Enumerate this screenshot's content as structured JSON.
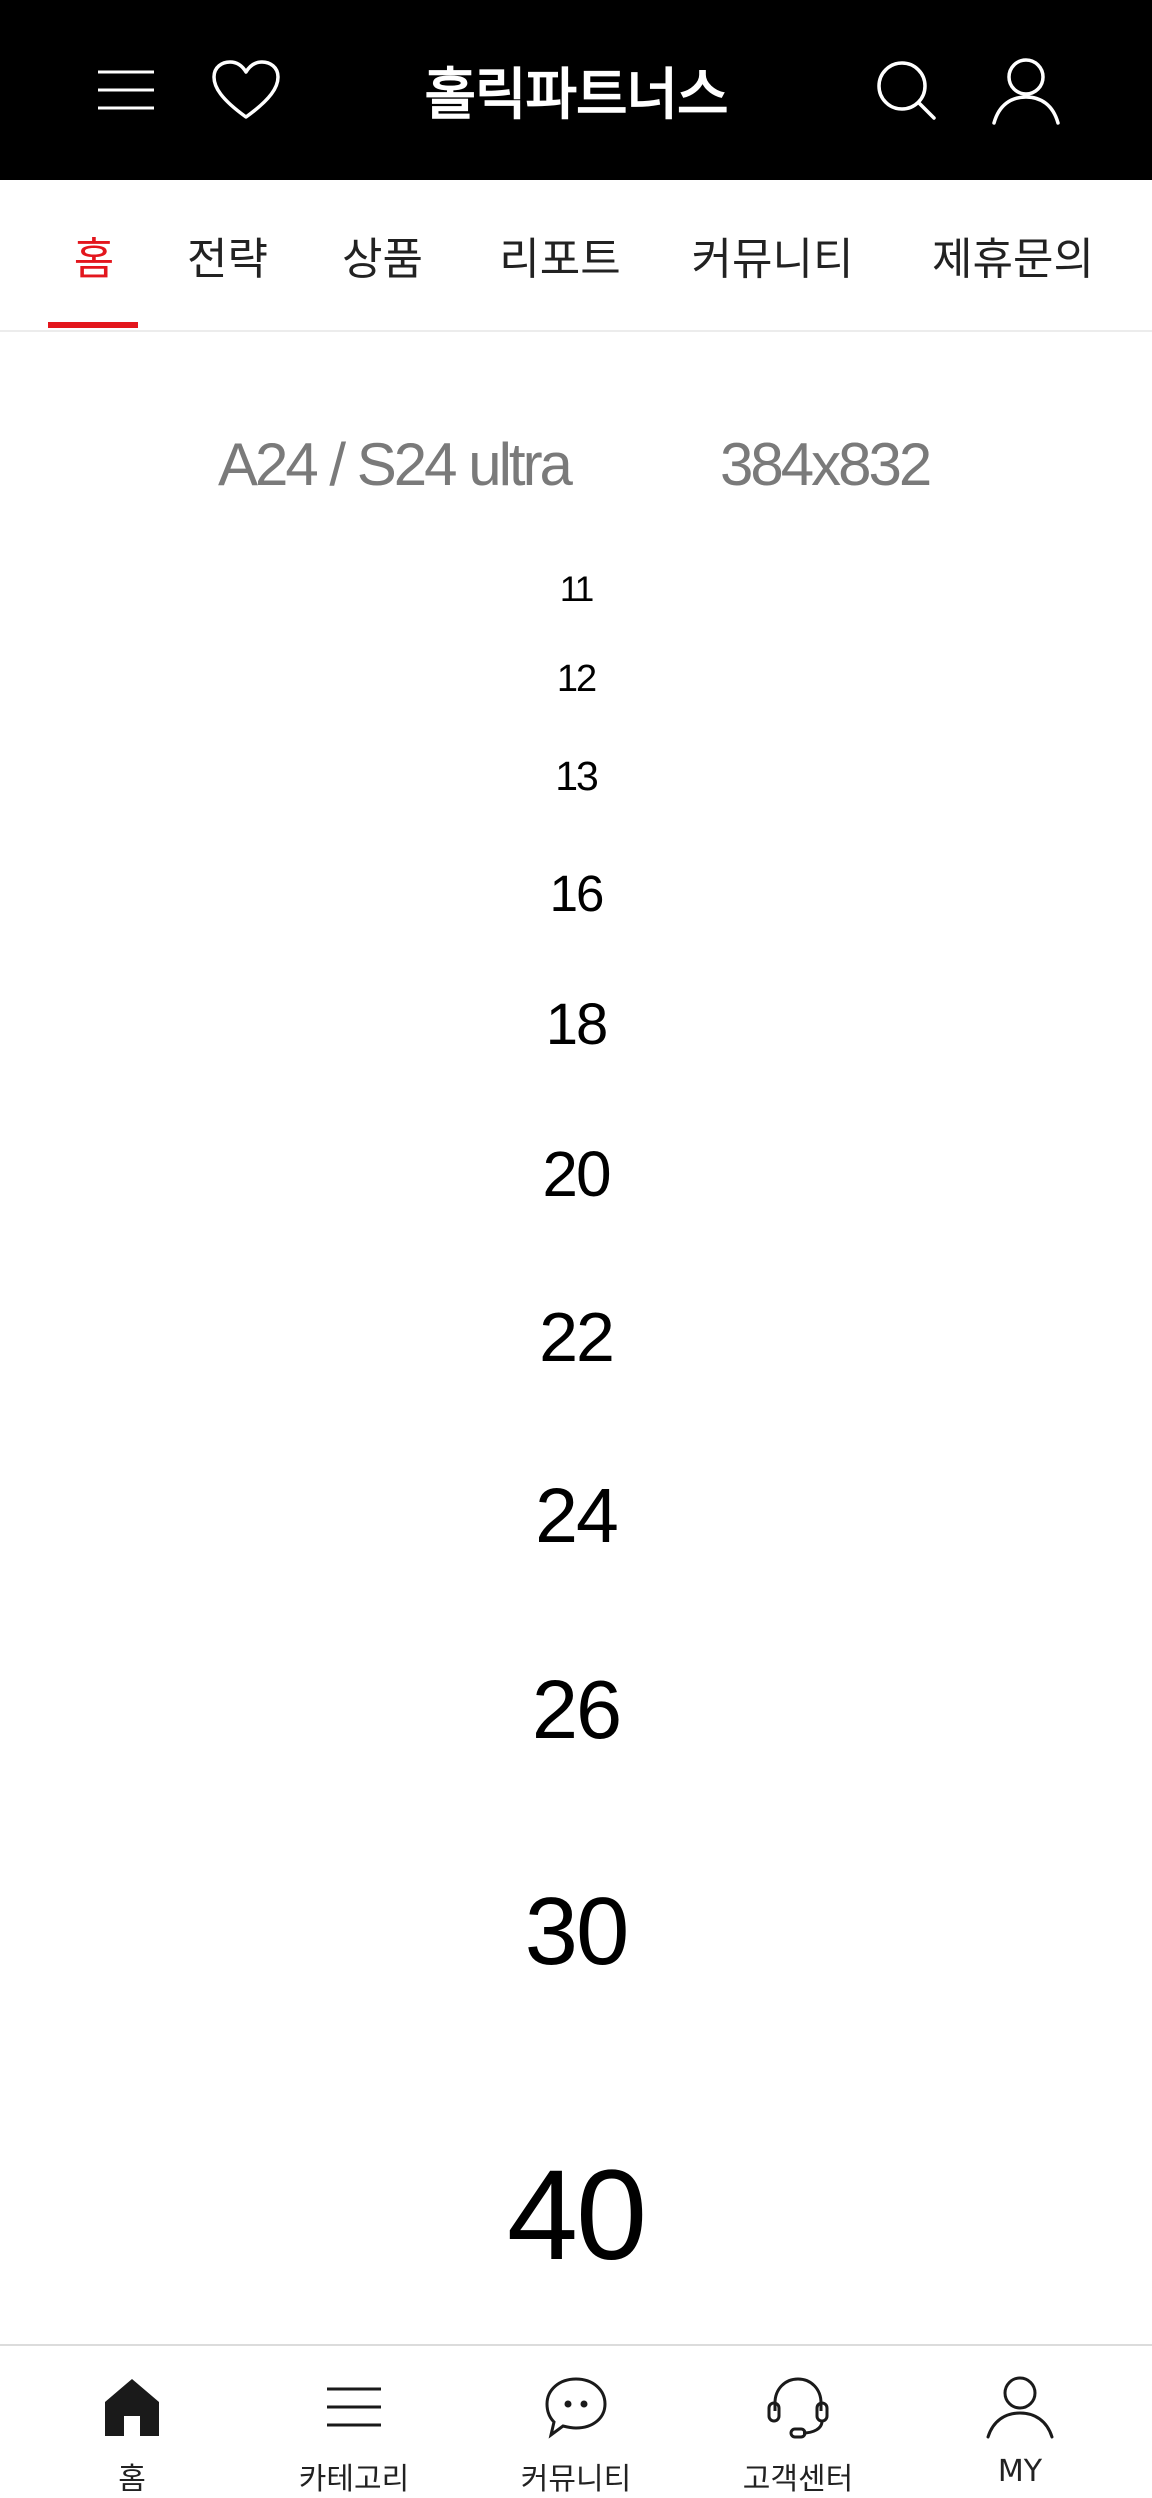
{
  "header": {
    "title": "홀릭파트너스",
    "icons": [
      "menu-icon",
      "heart-icon",
      "search-icon",
      "user-icon"
    ]
  },
  "tabs": [
    {
      "label": "홈",
      "active": true
    },
    {
      "label": "전략",
      "active": false
    },
    {
      "label": "상품",
      "active": false
    },
    {
      "label": "리포트",
      "active": false
    },
    {
      "label": "커뮤니티",
      "active": false
    },
    {
      "label": "제휴문의",
      "active": false
    }
  ],
  "device": {
    "model": "A24 / S24 ultra",
    "resolution": "384x832"
  },
  "font_samples": [
    "11",
    "12",
    "13",
    "16",
    "18",
    "20",
    "22",
    "24",
    "26",
    "30",
    "40"
  ],
  "bottom_nav": [
    {
      "label": "홈",
      "icon": "home-icon"
    },
    {
      "label": "카테고리",
      "icon": "category-menu-icon"
    },
    {
      "label": "커뮤니티",
      "icon": "chat-bubble-icon"
    },
    {
      "label": "고객센터",
      "icon": "headset-icon"
    },
    {
      "label": "MY",
      "icon": "user-icon"
    }
  ],
  "colors": {
    "header_bg": "#000000",
    "accent": "#e3161d",
    "device_text": "#7a7a7a"
  }
}
